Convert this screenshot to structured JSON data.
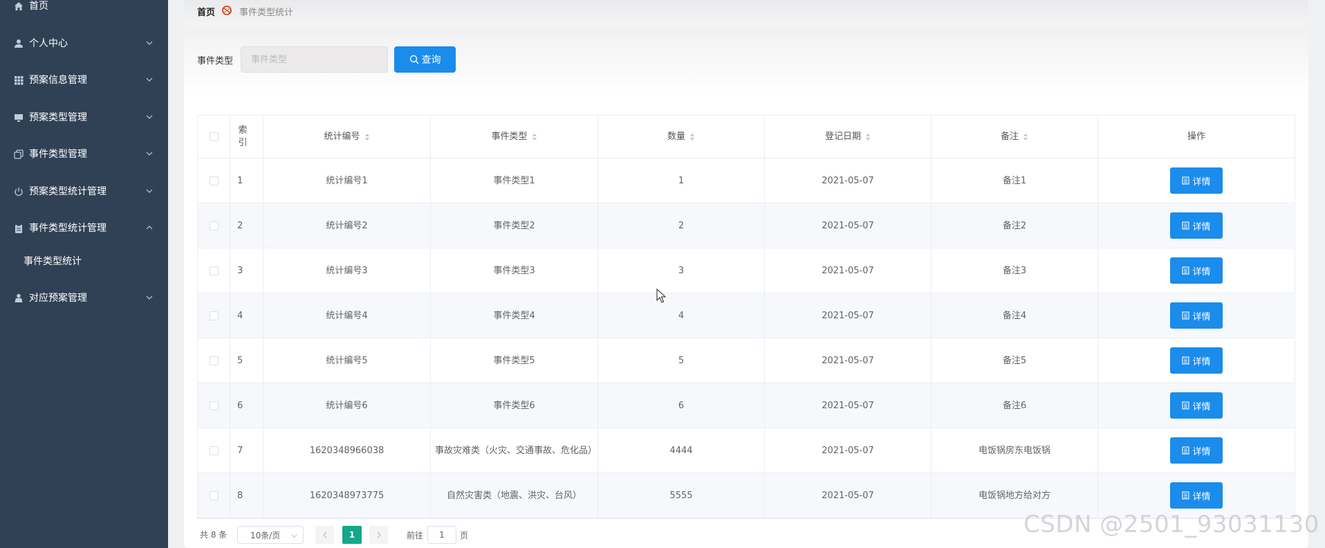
{
  "sidebar": {
    "items": [
      {
        "label": "首页",
        "icon": "home-icon",
        "expandable": false
      },
      {
        "label": "个人中心",
        "icon": "user-icon",
        "expandable": true
      },
      {
        "label": "预案信息管理",
        "icon": "grid-icon",
        "expandable": true
      },
      {
        "label": "预案类型管理",
        "icon": "monitor-icon",
        "expandable": true
      },
      {
        "label": "事件类型管理",
        "icon": "copy-icon",
        "expandable": true
      },
      {
        "label": "预案类型统计管理",
        "icon": "power-icon",
        "expandable": true
      },
      {
        "label": "事件类型统计管理",
        "icon": "clipboard-icon",
        "expandable": true,
        "expanded": true
      },
      {
        "label": "对应预案管理",
        "icon": "person-icon",
        "expandable": true
      }
    ],
    "subitem": "事件类型统计"
  },
  "breadcrumb": {
    "home": "首页",
    "current": "事件类型统计"
  },
  "search": {
    "label": "事件类型",
    "placeholder": "事件类型",
    "button": "查询"
  },
  "table": {
    "headers": {
      "index": "索引",
      "code": "统计编号",
      "type": "事件类型",
      "count": "数量",
      "date": "登记日期",
      "remark": "备注",
      "action": "操作"
    },
    "detail_label": "详情",
    "rows": [
      {
        "index": "1",
        "code": "统计编号1",
        "type": "事件类型1",
        "count": "1",
        "date": "2021-05-07",
        "remark": "备注1"
      },
      {
        "index": "2",
        "code": "统计编号2",
        "type": "事件类型2",
        "count": "2",
        "date": "2021-05-07",
        "remark": "备注2"
      },
      {
        "index": "3",
        "code": "统计编号3",
        "type": "事件类型3",
        "count": "3",
        "date": "2021-05-07",
        "remark": "备注3"
      },
      {
        "index": "4",
        "code": "统计编号4",
        "type": "事件类型4",
        "count": "4",
        "date": "2021-05-07",
        "remark": "备注4"
      },
      {
        "index": "5",
        "code": "统计编号5",
        "type": "事件类型5",
        "count": "5",
        "date": "2021-05-07",
        "remark": "备注5"
      },
      {
        "index": "6",
        "code": "统计编号6",
        "type": "事件类型6",
        "count": "6",
        "date": "2021-05-07",
        "remark": "备注6"
      },
      {
        "index": "7",
        "code": "1620348966038",
        "type": "事故灾难类（火灾、交通事故、危化品）",
        "count": "4444",
        "date": "2021-05-07",
        "remark": "电饭锅房东电饭锅"
      },
      {
        "index": "8",
        "code": "1620348973775",
        "type": "自然灾害类（地震、洪灾、台风）",
        "count": "5555",
        "date": "2021-05-07",
        "remark": "电饭锅地方给对方"
      }
    ]
  },
  "pagination": {
    "total": "共 8 条",
    "page_size": "10条/页",
    "current_page": "1",
    "goto": "前往",
    "goto_value": "1",
    "page_unit": "页"
  },
  "watermark": "CSDN @2501_93031130",
  "colors": {
    "sidebar_bg": "#304156",
    "primary": "#1a8cec",
    "pager_active": "#13a78c"
  }
}
